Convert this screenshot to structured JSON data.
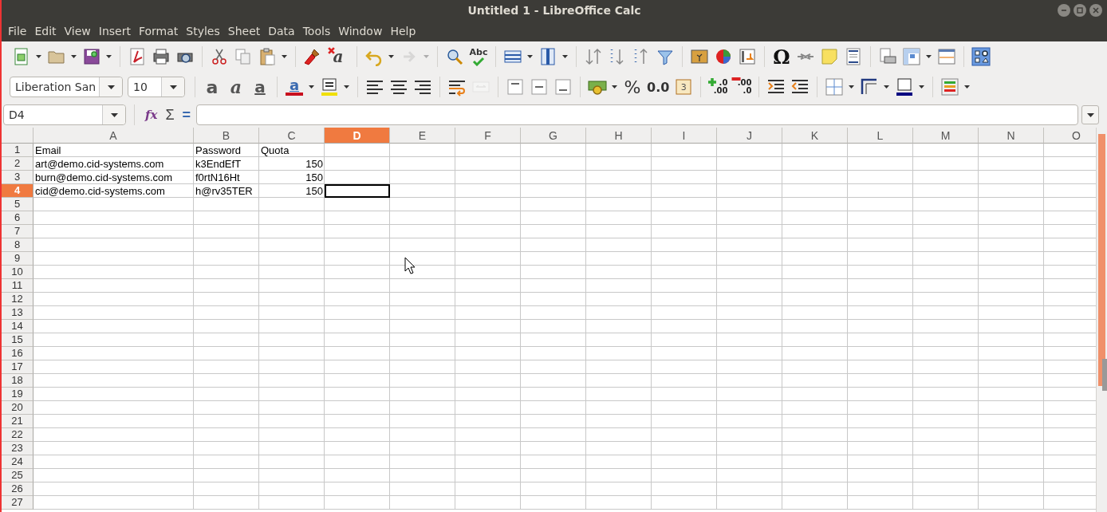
{
  "window": {
    "title": "Untitled 1 - LibreOffice Calc"
  },
  "menu": [
    "File",
    "Edit",
    "View",
    "Insert",
    "Format",
    "Styles",
    "Sheet",
    "Data",
    "Tools",
    "Window",
    "Help"
  ],
  "toolbar_standard": [
    [
      {
        "kind": "new",
        "dropdown": true,
        "disabled": false
      },
      {
        "kind": "open",
        "dropdown": true,
        "disabled": false
      },
      {
        "kind": "save",
        "dropdown": true,
        "disabled": false
      }
    ],
    [
      {
        "kind": "pdf",
        "dropdown": false,
        "disabled": false
      },
      {
        "kind": "print",
        "dropdown": false,
        "disabled": false
      },
      {
        "kind": "preview",
        "dropdown": false,
        "disabled": false
      }
    ],
    [
      {
        "kind": "cut",
        "dropdown": false,
        "disabled": false
      },
      {
        "kind": "copy",
        "dropdown": false,
        "disabled": false
      },
      {
        "kind": "paste",
        "dropdown": true,
        "disabled": false
      }
    ],
    [
      {
        "kind": "brush",
        "dropdown": false,
        "disabled": false
      },
      {
        "kind": "clear",
        "dropdown": false,
        "disabled": false,
        "glyphs": [
          "a"
        ]
      }
    ],
    [
      {
        "kind": "undo",
        "dropdown": true,
        "disabled": false
      },
      {
        "kind": "redo",
        "dropdown": true,
        "disabled": true
      }
    ],
    [
      {
        "kind": "find",
        "dropdown": false,
        "disabled": false
      },
      {
        "kind": "spell",
        "dropdown": false,
        "disabled": false,
        "glyphs": [
          "Abc"
        ]
      }
    ],
    [
      {
        "kind": "rows",
        "dropdown": true,
        "disabled": false
      },
      {
        "kind": "columns",
        "dropdown": true,
        "disabled": false
      }
    ],
    [
      {
        "kind": "sort",
        "dropdown": false,
        "disabled": false
      },
      {
        "kind": "sort-down",
        "dropdown": false,
        "disabled": false
      },
      {
        "kind": "sort-up",
        "dropdown": false,
        "disabled": false
      },
      {
        "kind": "filter",
        "dropdown": false,
        "disabled": false
      }
    ],
    [
      {
        "kind": "image",
        "dropdown": false,
        "disabled": false
      },
      {
        "kind": "chart",
        "dropdown": false,
        "disabled": false
      },
      {
        "kind": "pivot",
        "dropdown": false,
        "disabled": false
      }
    ],
    [
      {
        "kind": "special",
        "dropdown": false,
        "disabled": false,
        "glyphs": [
          "Ω"
        ]
      },
      {
        "kind": "link",
        "dropdown": false,
        "disabled": false
      },
      {
        "kind": "note",
        "dropdown": false,
        "disabled": false
      },
      {
        "kind": "header",
        "dropdown": false,
        "disabled": false
      }
    ],
    [
      {
        "kind": "pages",
        "dropdown": false,
        "disabled": false
      },
      {
        "kind": "freeze",
        "dropdown": true,
        "disabled": false
      },
      {
        "kind": "split",
        "dropdown": false,
        "disabled": false
      }
    ],
    [
      {
        "kind": "shapes",
        "dropdown": false,
        "disabled": false
      }
    ]
  ],
  "toolbar_formatting": [
    [
      {
        "kind": "font-name",
        "value": "Liberation San",
        "dropdown": true,
        "disabled": false
      },
      {
        "kind": "font-size",
        "value": "10",
        "dropdown": true,
        "disabled": false
      }
    ],
    [
      {
        "kind": "bold",
        "dropdown": false,
        "disabled": false,
        "glyphs": [
          "a"
        ]
      },
      {
        "kind": "italic",
        "dropdown": false,
        "disabled": false,
        "glyphs": [
          "a"
        ]
      },
      {
        "kind": "underline",
        "dropdown": false,
        "disabled": false,
        "glyphs": [
          "a"
        ]
      }
    ],
    [
      {
        "kind": "font-color",
        "dropdown": true,
        "disabled": false,
        "glyphs": [
          "a"
        ]
      },
      {
        "kind": "highlight",
        "dropdown": true,
        "disabled": false
      }
    ],
    [
      {
        "kind": "align-left",
        "dropdown": false,
        "disabled": false
      },
      {
        "kind": "align-center",
        "dropdown": false,
        "disabled": false
      },
      {
        "kind": "align-right",
        "dropdown": false,
        "disabled": false
      }
    ],
    [
      {
        "kind": "wrap",
        "dropdown": false,
        "disabled": false
      },
      {
        "kind": "merge",
        "dropdown": false,
        "disabled": true
      }
    ],
    [
      {
        "kind": "valign-top",
        "dropdown": false,
        "disabled": false
      },
      {
        "kind": "valign-center",
        "dropdown": false,
        "disabled": false
      },
      {
        "kind": "valign-bottom",
        "dropdown": false,
        "disabled": false
      }
    ],
    [
      {
        "kind": "currency",
        "dropdown": true,
        "disabled": false
      },
      {
        "kind": "percent",
        "dropdown": false,
        "disabled": false,
        "glyphs": [
          "%"
        ]
      },
      {
        "kind": "number",
        "dropdown": false,
        "disabled": false,
        "glyphs": [
          "0.0"
        ]
      },
      {
        "kind": "date",
        "dropdown": false,
        "disabled": false,
        "glyphs": [
          "3"
        ]
      }
    ],
    [
      {
        "kind": "add-decimal",
        "dropdown": false,
        "disabled": false,
        "glyphs": [
          ".0",
          ".00"
        ]
      },
      {
        "kind": "del-decimal",
        "dropdown": false,
        "disabled": false,
        "glyphs": [
          ".00",
          ".0"
        ]
      }
    ],
    [
      {
        "kind": "indent-more",
        "dropdown": false,
        "disabled": false
      },
      {
        "kind": "indent-less",
        "dropdown": false,
        "disabled": false
      }
    ],
    [
      {
        "kind": "borders",
        "dropdown": true,
        "disabled": false
      },
      {
        "kind": "border-style",
        "dropdown": true,
        "disabled": false
      },
      {
        "kind": "border-color",
        "dropdown": true,
        "disabled": false
      }
    ],
    [
      {
        "kind": "conditional",
        "dropdown": true,
        "disabled": false
      }
    ]
  ],
  "formula_bar": {
    "name_box": "D4",
    "function_wizard": "fx",
    "sum": "Σ",
    "formula": "="
  },
  "sheet": {
    "columns": [
      {
        "label": "A",
        "selected": false
      },
      {
        "label": "B",
        "selected": false
      },
      {
        "label": "C",
        "selected": false
      },
      {
        "label": "D",
        "selected": true
      },
      {
        "label": "E",
        "selected": false
      },
      {
        "label": "F",
        "selected": false
      },
      {
        "label": "G",
        "selected": false
      },
      {
        "label": "H",
        "selected": false
      },
      {
        "label": "I",
        "selected": false
      },
      {
        "label": "J",
        "selected": false
      },
      {
        "label": "K",
        "selected": false
      },
      {
        "label": "L",
        "selected": false
      },
      {
        "label": "M",
        "selected": false
      },
      {
        "label": "N",
        "selected": false
      },
      {
        "label": "O",
        "selected": false
      }
    ],
    "rows": [
      {
        "label": "1",
        "selected": false,
        "cells": [
          {
            "text": "Email",
            "kind": "text"
          },
          {
            "text": "Password",
            "kind": "text"
          },
          {
            "text": "Quota",
            "kind": "text"
          }
        ]
      },
      {
        "label": "2",
        "selected": false,
        "cells": [
          {
            "text": "art@demo.cid-systems.com",
            "kind": "text"
          },
          {
            "text": "k3EndEfT",
            "kind": "text"
          },
          {
            "text": "150",
            "kind": "number"
          }
        ]
      },
      {
        "label": "3",
        "selected": false,
        "cells": [
          {
            "text": "burn@demo.cid-systems.com",
            "kind": "text"
          },
          {
            "text": "f0rtN16Ht",
            "kind": "text"
          },
          {
            "text": "150",
            "kind": "number"
          }
        ]
      },
      {
        "label": "4",
        "selected": true,
        "cells": [
          {
            "text": "cid@demo.cid-systems.com",
            "kind": "text"
          },
          {
            "text": "h@rv35TER",
            "kind": "text"
          },
          {
            "text": "150",
            "kind": "number"
          }
        ]
      },
      {
        "label": "5",
        "selected": false,
        "cells": []
      },
      {
        "label": "6",
        "selected": false,
        "cells": []
      },
      {
        "label": "7",
        "selected": false,
        "cells": []
      },
      {
        "label": "8",
        "selected": false,
        "cells": []
      },
      {
        "label": "9",
        "selected": false,
        "cells": []
      },
      {
        "label": "10",
        "selected": false,
        "cells": []
      },
      {
        "label": "11",
        "selected": false,
        "cells": []
      },
      {
        "label": "12",
        "selected": false,
        "cells": []
      },
      {
        "label": "13",
        "selected": false,
        "cells": []
      },
      {
        "label": "14",
        "selected": false,
        "cells": []
      },
      {
        "label": "15",
        "selected": false,
        "cells": []
      },
      {
        "label": "16",
        "selected": false,
        "cells": []
      },
      {
        "label": "17",
        "selected": false,
        "cells": []
      },
      {
        "label": "18",
        "selected": false,
        "cells": []
      },
      {
        "label": "19",
        "selected": false,
        "cells": []
      },
      {
        "label": "20",
        "selected": false,
        "cells": []
      },
      {
        "label": "21",
        "selected": false,
        "cells": []
      },
      {
        "label": "22",
        "selected": false,
        "cells": []
      },
      {
        "label": "23",
        "selected": false,
        "cells": []
      },
      {
        "label": "24",
        "selected": false,
        "cells": []
      },
      {
        "label": "25",
        "selected": false,
        "cells": []
      },
      {
        "label": "26",
        "selected": false,
        "cells": []
      },
      {
        "label": "27",
        "selected": false,
        "cells": []
      }
    ]
  }
}
